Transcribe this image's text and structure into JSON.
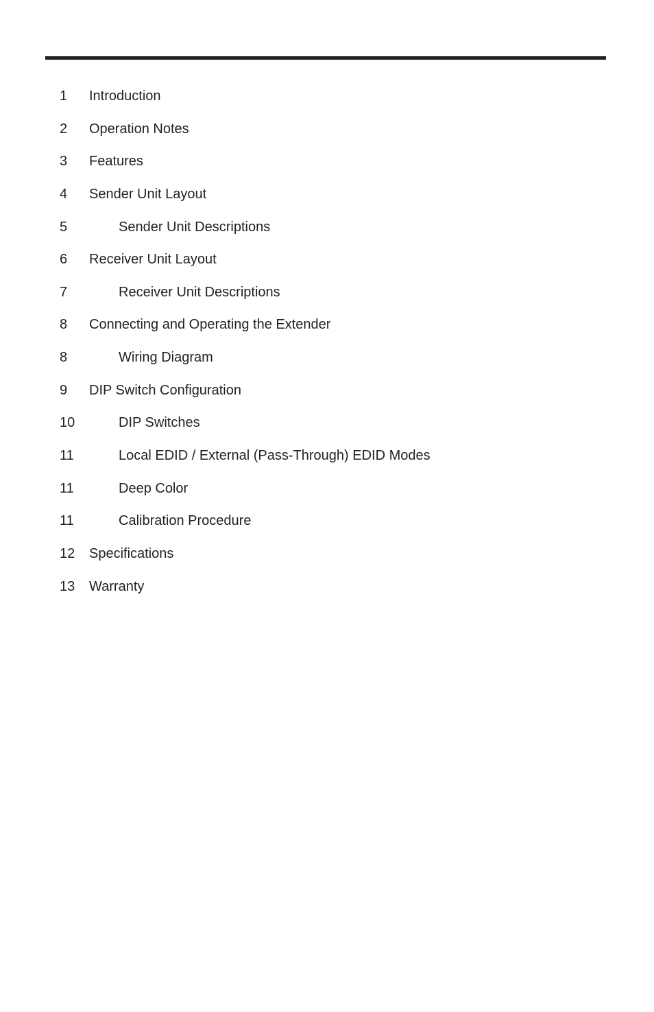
{
  "document": {
    "section": "table-of-contents",
    "rule_color": "#231f20",
    "text_color": "#231f20"
  },
  "toc": {
    "entries": [
      {
        "page": "1",
        "title": "Introduction",
        "level": 1
      },
      {
        "page": "2",
        "title": "Operation Notes",
        "level": 1
      },
      {
        "page": "3",
        "title": "Features",
        "level": 1
      },
      {
        "page": "4",
        "title": "Sender Unit Layout",
        "level": 1
      },
      {
        "page": "5",
        "title": "Sender Unit Descriptions",
        "level": 2
      },
      {
        "page": "6",
        "title": "Receiver Unit Layout",
        "level": 1
      },
      {
        "page": "7",
        "title": "Receiver Unit Descriptions",
        "level": 2
      },
      {
        "page": "8",
        "title": "Connecting and Operating the Extender",
        "level": 1
      },
      {
        "page": "8",
        "title": "Wiring Diagram",
        "level": 2
      },
      {
        "page": "9",
        "title": "DIP Switch Configuration",
        "level": 1
      },
      {
        "page": "10",
        "title": "DIP Switches",
        "level": 2
      },
      {
        "page": "11",
        "title": "Local EDID / External (Pass-Through) EDID Modes",
        "level": 2
      },
      {
        "page": "11",
        "title": "Deep Color",
        "level": 2
      },
      {
        "page": "11",
        "title": "Calibration Procedure",
        "level": 2
      },
      {
        "page": "12",
        "title": "Specifications",
        "level": 1
      },
      {
        "page": "13",
        "title": "Warranty",
        "level": 1
      }
    ]
  }
}
